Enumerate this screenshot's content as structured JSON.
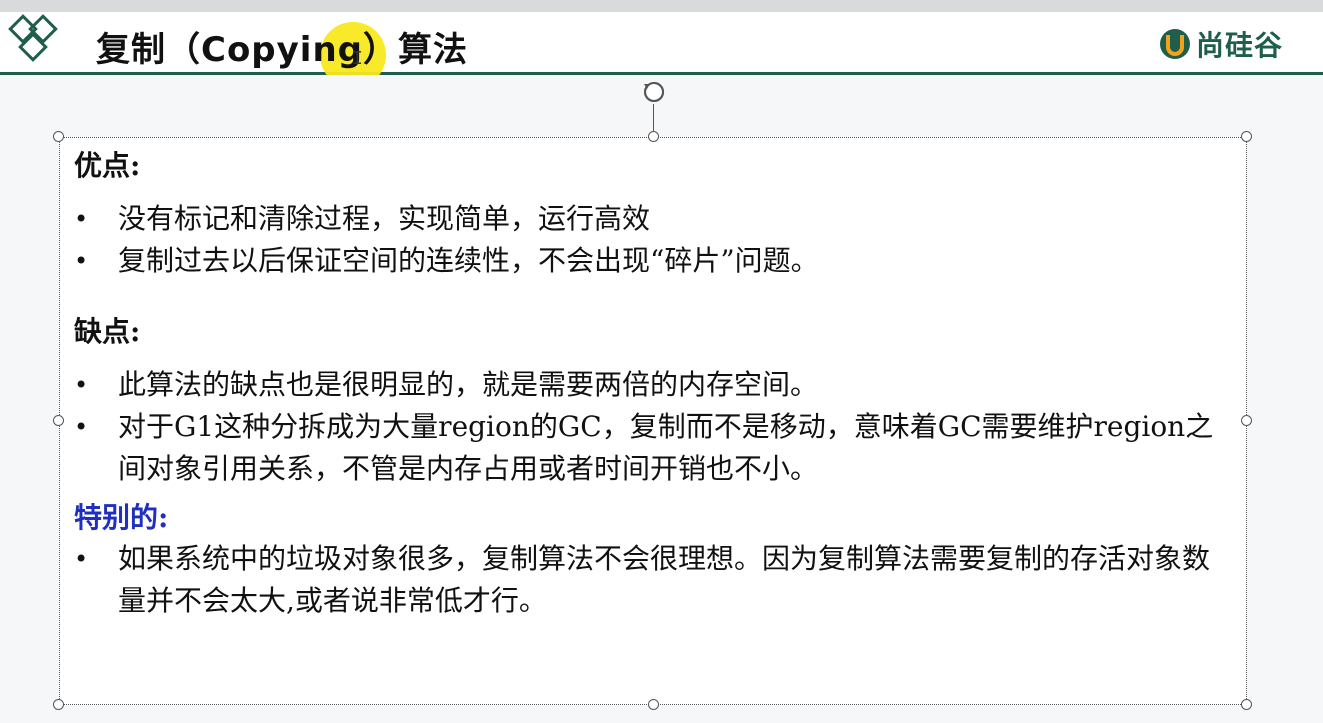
{
  "slide": {
    "title": "复制（Copying）算法",
    "brand_text": "尚硅谷"
  },
  "pros": {
    "heading": "优点:",
    "items": [
      "没有标记和清除过程，实现简单，运行高效",
      "复制过去以后保证空间的连续性，不会出现“碎片”问题。"
    ]
  },
  "cons": {
    "heading": "缺点:",
    "items": [
      "此算法的缺点也是很明显的，就是需要两倍的内存空间。",
      "对于G1这种分拆成为大量region的GC，复制而不是移动，意味着GC需要维护region之间对象引用关系，不管是内存占用或者时间开销也不小。"
    ]
  },
  "special": {
    "heading": "特别的:",
    "items": [
      "如果系统中的垃圾对象很多，复制算法不会很理想。因为复制算法需要复制的存活对象数量并不会太大,或者说非常低才行。"
    ]
  },
  "bullet_symbol": "•",
  "colors": {
    "brand_green": "#1e5e4a",
    "special_heading": "#1f2fbf",
    "cursor_highlight": "#f8e81e"
  }
}
